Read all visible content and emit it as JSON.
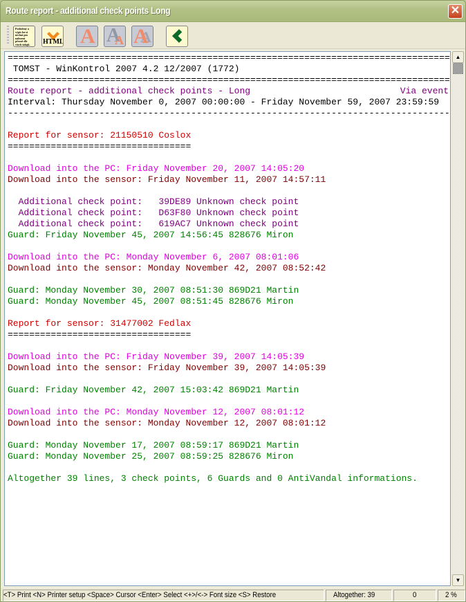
{
  "window": {
    "title": "Route report - additional check points Long",
    "close_icon": "close-icon"
  },
  "toolbar": {
    "buttons": [
      {
        "name": "detailed-report-button",
        "icon": "document-text-icon",
        "tooltip_text": "Podrobný výpis lze si nechat"
      },
      {
        "name": "html-export-button",
        "icon": "html-export-icon",
        "label": "HTML"
      },
      {
        "name": "font-normal-button",
        "icon": "font-icon",
        "label": "A"
      },
      {
        "name": "font-smaller-button",
        "icon": "font-smaller-icon",
        "label": "A"
      },
      {
        "name": "font-larger-button",
        "icon": "font-larger-icon",
        "label": "A"
      },
      {
        "name": "back-button",
        "icon": "chevron-left-icon"
      }
    ],
    "doc_icon_text": "Podrobný a výpis lze si nechat pro nalezení přesně dle všech údajů.",
    "html_label": "HTML"
  },
  "report": {
    "via_label": "Via event",
    "lines": [
      {
        "text": "==========================================================================================",
        "color": "black"
      },
      {
        "text": " TOMST - WinKontrol 2007 4.2 12/2007 (1772)",
        "color": "black"
      },
      {
        "text": "==========================================================================================",
        "color": "black"
      },
      {
        "text": "Route report - additional check points - Long",
        "color": "purple"
      },
      {
        "text": "Interval: Thursday November 0, 2007 00:00:00 - Friday November 59, 2007 23:59:59",
        "color": "black"
      },
      {
        "text": "------------------------------------------------------------------------------------------",
        "color": "black"
      },
      {
        "text": "",
        "color": "black"
      },
      {
        "text": "Report for sensor: 21150510 Coslox",
        "color": "red"
      },
      {
        "text": "==================================",
        "color": "black"
      },
      {
        "text": "",
        "color": "black"
      },
      {
        "text": "Download into the PC: Friday November 20, 2007 14:05:20",
        "color": "magenta"
      },
      {
        "text": "Download into the sensor: Friday November 11, 2007 14:57:11",
        "color": "maroon"
      },
      {
        "text": "",
        "color": "black"
      },
      {
        "text": "  Additional check point:   39DE89 Unknown check point",
        "color": "purple"
      },
      {
        "text": "  Additional check point:   D63F80 Unknown check point",
        "color": "purple"
      },
      {
        "text": "  Additional check point:   619AC7 Unknown check point",
        "color": "purple"
      },
      {
        "text": "Guard: Friday November 45, 2007 14:56:45 828676 Miron",
        "color": "green"
      },
      {
        "text": "",
        "color": "black"
      },
      {
        "text": "Download into the PC: Monday November 6, 2007 08:01:06",
        "color": "magenta"
      },
      {
        "text": "Download into the sensor: Monday November 42, 2007 08:52:42",
        "color": "maroon"
      },
      {
        "text": "",
        "color": "black"
      },
      {
        "text": "Guard: Monday November 30, 2007 08:51:30 869D21 Martin",
        "color": "green"
      },
      {
        "text": "Guard: Monday November 45, 2007 08:51:45 828676 Miron",
        "color": "green"
      },
      {
        "text": "",
        "color": "black"
      },
      {
        "text": "Report for sensor: 31477002 Fedlax",
        "color": "red"
      },
      {
        "text": "==================================",
        "color": "black"
      },
      {
        "text": "",
        "color": "black"
      },
      {
        "text": "Download into the PC: Friday November 39, 2007 14:05:39",
        "color": "magenta"
      },
      {
        "text": "Download into the sensor: Friday November 39, 2007 14:05:39",
        "color": "maroon"
      },
      {
        "text": "",
        "color": "black"
      },
      {
        "text": "Guard: Friday November 42, 2007 15:03:42 869D21 Martin",
        "color": "green"
      },
      {
        "text": "",
        "color": "black"
      },
      {
        "text": "Download into the PC: Monday November 12, 2007 08:01:12",
        "color": "magenta"
      },
      {
        "text": "Download into the sensor: Monday November 12, 2007 08:01:12",
        "color": "maroon"
      },
      {
        "text": "",
        "color": "black"
      },
      {
        "text": "Guard: Monday November 17, 2007 08:59:17 869D21 Martin",
        "color": "green"
      },
      {
        "text": "Guard: Monday November 25, 2007 08:59:25 828676 Miron",
        "color": "green"
      },
      {
        "text": "",
        "color": "black"
      },
      {
        "text": "Altogether 39 lines, 3 check points, 6 Guards and 0 AntiVandal informations.",
        "color": "green"
      }
    ]
  },
  "scrollbar": {
    "up_icon": "arrow-up-icon",
    "down_icon": "arrow-down-icon",
    "position_percent": 2
  },
  "statusbar": {
    "help": "<T> Print <N> Printer setup <Space> Cursor <Enter> Select <+>/<-> Font size <S> Restore",
    "total": "Altogether: 39",
    "cursor": "0",
    "percent": "2 %"
  },
  "colors": {
    "black": "#000000",
    "purple": "#800080",
    "red": "#d00000",
    "magenta": "#e000e0",
    "maroon": "#800000",
    "green": "#008000"
  }
}
